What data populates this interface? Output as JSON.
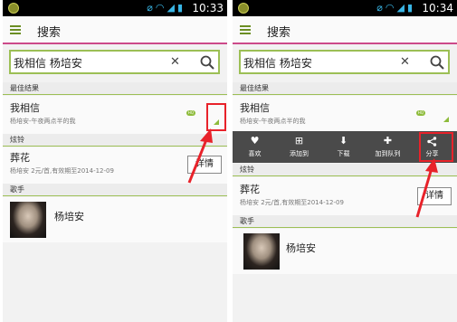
{
  "colors": {
    "accent": "#9cbf55",
    "highlight": "#e8222a",
    "appbar_underline": "#cc4a8a"
  },
  "left": {
    "status": {
      "time": "10:33"
    },
    "appbar": {
      "title": "搜索"
    },
    "search": {
      "value": "我相信 杨培安"
    },
    "sections": {
      "best": "最佳结果",
      "ringtone": "炫铃",
      "artist": "歌手"
    },
    "best_result": {
      "title": "我相信",
      "subtitle": "杨培安-午夜两点半的我",
      "badge": "HQ"
    },
    "ringtone_item": {
      "title": "葬花",
      "subtitle": "杨培安   2元/首,有效期至2014-12-09",
      "detail_label": "详情"
    },
    "artist_item": {
      "name": "杨培安"
    }
  },
  "right": {
    "status": {
      "time": "10:34"
    },
    "appbar": {
      "title": "搜索"
    },
    "search": {
      "value": "我相信 杨培安"
    },
    "sections": {
      "best": "最佳结果",
      "ringtone": "炫铃",
      "artist": "歌手"
    },
    "best_result": {
      "title": "我相信",
      "subtitle": "杨培安-午夜两点半的我",
      "badge": "HQ"
    },
    "actions": [
      {
        "icon": "heart-icon",
        "label": "喜欢"
      },
      {
        "icon": "add-to-icon",
        "label": "添加到"
      },
      {
        "icon": "download-icon",
        "label": "下载"
      },
      {
        "icon": "plus-icon",
        "label": "加到队列"
      },
      {
        "icon": "share-icon",
        "label": "分享"
      }
    ],
    "ringtone_item": {
      "title": "葬花",
      "subtitle": "杨培安   2元/首,有效期至2014-12-09",
      "detail_label": "详情"
    },
    "artist_item": {
      "name": "杨培安"
    }
  }
}
